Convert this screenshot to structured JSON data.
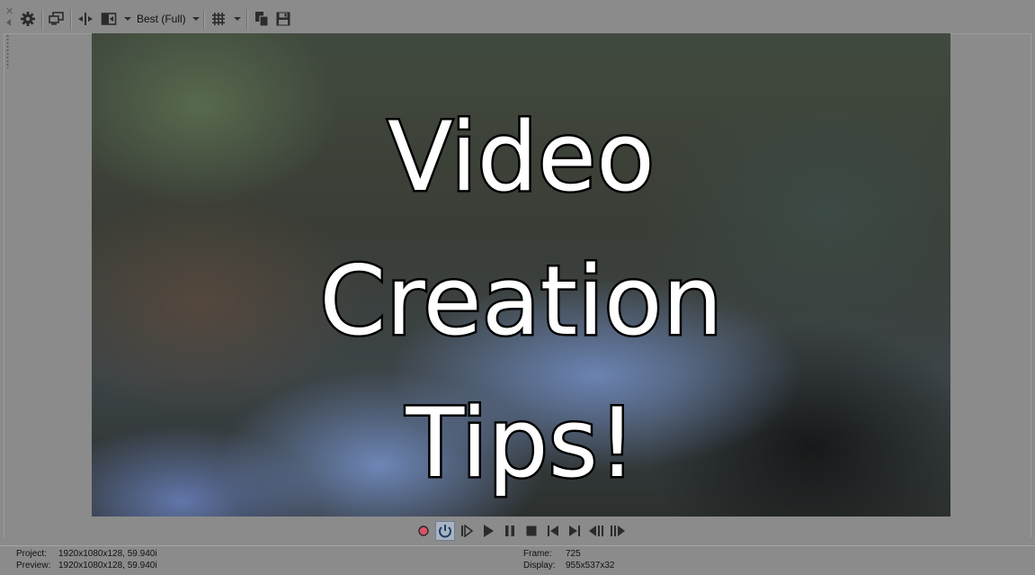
{
  "toolbar": {
    "quality_label": "Best (Full)",
    "icons": [
      "gear-icon",
      "external-monitor-icon",
      "split-screen-icon",
      "overlay-toggle-icon",
      "grid-icon",
      "copy-snapshot-icon",
      "save-snapshot-icon"
    ]
  },
  "preview": {
    "lines": [
      "Video",
      "Creation",
      "Tips!"
    ]
  },
  "transport": {
    "buttons": [
      "record",
      "loop",
      "play-from-start",
      "play",
      "pause",
      "stop",
      "go-to-start",
      "go-to-end",
      "previous-frame",
      "next-frame"
    ],
    "record_color": "#d9536a",
    "loop_active_color": "#1e3f66"
  },
  "status": {
    "project_label": "Project:",
    "project_value": "1920x1080x128, 59.940i",
    "preview_label": "Preview:",
    "preview_value": "1920x1080x128, 59.940i",
    "frame_label": "Frame:",
    "frame_value": "725",
    "display_label": "Display:",
    "display_value": "955x537x32"
  }
}
